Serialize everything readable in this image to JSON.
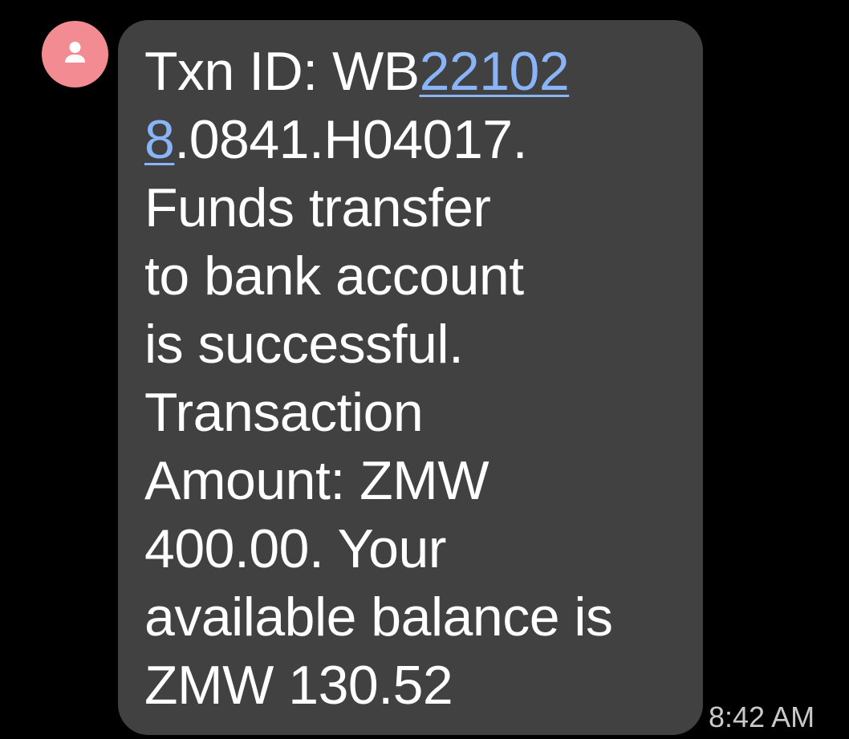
{
  "conversation": {
    "sender_avatar_icon": "person-icon",
    "avatar_color": "#f28b92",
    "bubble_color": "#414141",
    "link_color": "#8ab4f8",
    "message": {
      "line1_prefix": "Txn ID: WB",
      "line1_link": "22102",
      "line2_link": "8",
      "line2_suffix": ".0841.H04017.",
      "line3": "Funds transfer",
      "line4": "to bank account",
      "line5": "is successful.",
      "line6": "Transaction",
      "line7": "Amount: ZMW",
      "line8": "400.00. Your",
      "line9": "available balance is",
      "line10": "ZMW 130.52"
    },
    "timestamp": "8:42 AM"
  }
}
